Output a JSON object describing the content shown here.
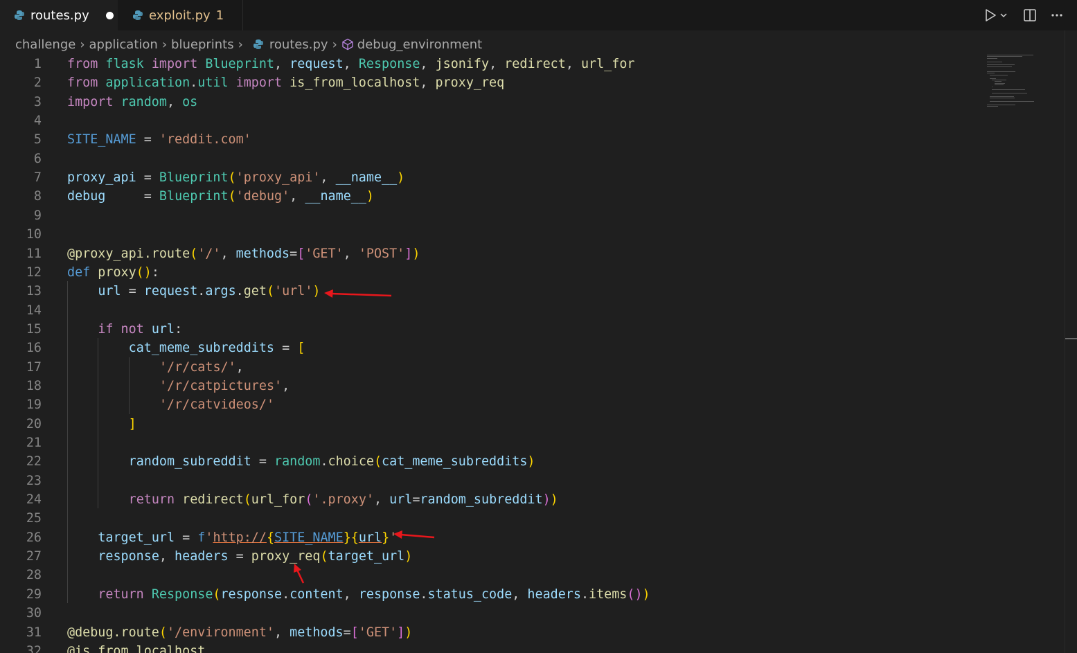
{
  "tabs": [
    {
      "label": "routes.py",
      "active": true,
      "dirty": true
    },
    {
      "label": "exploit.py",
      "badge": "1",
      "active": false
    }
  ],
  "actions": [
    "run-icon",
    "dropdown-icon",
    "split-editor-icon",
    "more-icon"
  ],
  "breadcrumb": [
    "challenge",
    "application",
    "blueprints",
    "routes.py",
    "debug_environment"
  ],
  "editor": {
    "lines": [
      {
        "n": "1",
        "t": "from flask import Blueprint, request, Response, jsonify, redirect, url_for"
      },
      {
        "n": "2",
        "t": "from application.util import is_from_localhost, proxy_req"
      },
      {
        "n": "3",
        "t": "import random, os"
      },
      {
        "n": "4",
        "t": ""
      },
      {
        "n": "5",
        "t": "SITE_NAME = 'reddit.com'"
      },
      {
        "n": "6",
        "t": ""
      },
      {
        "n": "7",
        "t": "proxy_api = Blueprint('proxy_api', __name__)"
      },
      {
        "n": "8",
        "t": "debug     = Blueprint('debug', __name__)"
      },
      {
        "n": "9",
        "t": ""
      },
      {
        "n": "10",
        "t": ""
      },
      {
        "n": "11",
        "t": "@proxy_api.route('/', methods=['GET', 'POST'])"
      },
      {
        "n": "12",
        "t": "def proxy():"
      },
      {
        "n": "13",
        "t": "    url = request.args.get('url')"
      },
      {
        "n": "14",
        "t": ""
      },
      {
        "n": "15",
        "t": "    if not url:"
      },
      {
        "n": "16",
        "t": "        cat_meme_subreddits = ["
      },
      {
        "n": "17",
        "t": "            '/r/cats/',"
      },
      {
        "n": "18",
        "t": "            '/r/catpictures',"
      },
      {
        "n": "19",
        "t": "            '/r/catvideos/'"
      },
      {
        "n": "20",
        "t": "        ]"
      },
      {
        "n": "21",
        "t": ""
      },
      {
        "n": "22",
        "t": "        random_subreddit = random.choice(cat_meme_subreddits)"
      },
      {
        "n": "23",
        "t": ""
      },
      {
        "n": "24",
        "t": "        return redirect(url_for('.proxy', url=random_subreddit))"
      },
      {
        "n": "25",
        "t": ""
      },
      {
        "n": "26",
        "t": "    target_url = f'http://{SITE_NAME}{url}'"
      },
      {
        "n": "27",
        "t": "    response, headers = proxy_req(target_url)"
      },
      {
        "n": "28",
        "t": ""
      },
      {
        "n": "29",
        "t": "    return Response(response.content, response.status_code, headers.items())"
      },
      {
        "n": "30",
        "t": ""
      },
      {
        "n": "31",
        "t": "@debug.route('/environment', methods=['GET'])"
      },
      {
        "n": "32",
        "t": "@is_from_localhost"
      }
    ]
  },
  "annotation_color": "#e8171c"
}
